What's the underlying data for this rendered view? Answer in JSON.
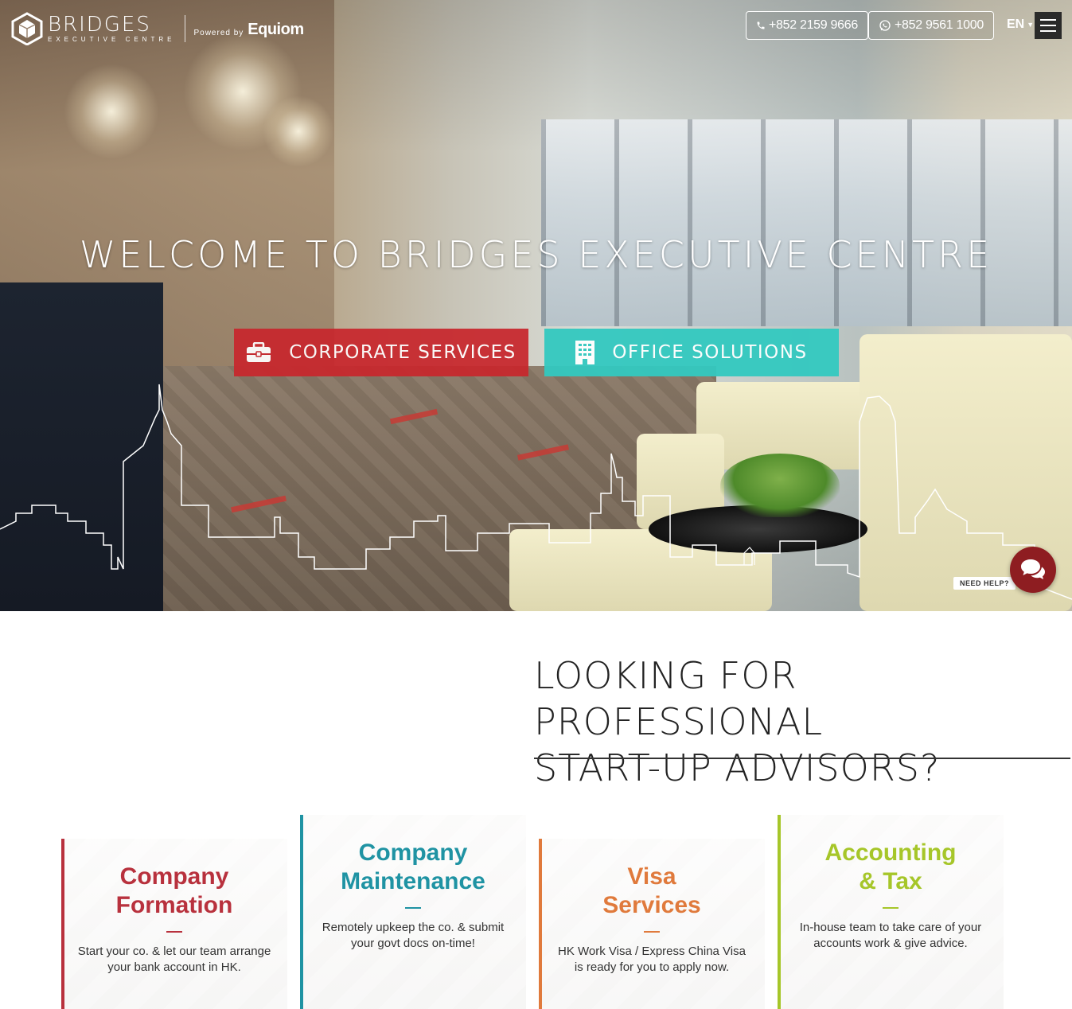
{
  "header": {
    "logo_name": "BRIDGES",
    "logo_sub": "EXECUTIVE CENTRE",
    "powered_by": "Powered by",
    "partner": "Equiom",
    "phone": "+852 2159 9666",
    "whatsapp": "+852 9561 1000",
    "language": "EN"
  },
  "hero": {
    "title": "WELCOME TO BRIDGES EXECUTIVE CENTRE",
    "cta_corporate": "CORPORATE SERVICES",
    "cta_office": "OFFICE SOLUTIONS"
  },
  "help": {
    "label": "NEED HELP?"
  },
  "section": {
    "title_line1": "LOOKING FOR PROFESSIONAL",
    "title_line2": "START-UP ADVISORS?"
  },
  "cards": [
    {
      "title_line1": "Company",
      "title_line2": "Formation",
      "text": "Start your co. & let our team arrange your bank account in HK.",
      "color": "#b8313d"
    },
    {
      "title_line1": "Company",
      "title_line2": "Maintenance",
      "text": "Remotely upkeep the co. & submit your govt docs on-time!",
      "color": "#1f93a3"
    },
    {
      "title_line1": "Visa",
      "title_line2": "Services",
      "text": "HK Work Visa / Express China Visa is ready for you to apply now.",
      "color": "#e07a3c"
    },
    {
      "title_line1": "Accounting",
      "title_line2": "& Tax",
      "text": "In-house team to take care of your accounts work & give advice.",
      "color": "#a6c629"
    }
  ],
  "colors": {
    "red": "#c8272d",
    "teal": "#33c9c0",
    "help_red": "#8e1d21"
  },
  "icons": [
    "cube-logo-icon",
    "phone-icon",
    "whatsapp-icon",
    "menu-icon",
    "briefcase-icon",
    "building-icon",
    "chat-icon"
  ]
}
